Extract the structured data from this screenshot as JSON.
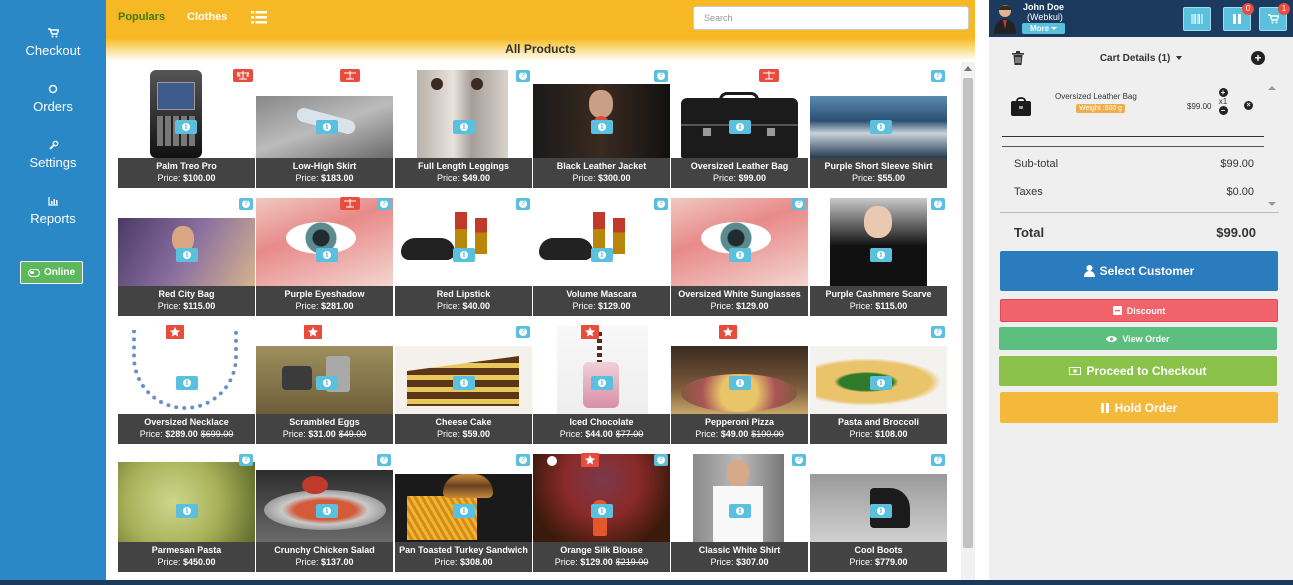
{
  "sidebar": {
    "items": [
      {
        "label": "Checkout",
        "icon": "cart-icon"
      },
      {
        "label": "Orders",
        "icon": "circle-icon"
      },
      {
        "label": "Settings",
        "icon": "wrench-icon"
      },
      {
        "label": "Reports",
        "icon": "bar-chart-icon"
      }
    ],
    "online_label": "Online"
  },
  "topbar": {
    "tabs": [
      {
        "label": "Populars"
      },
      {
        "label": "Clothes"
      }
    ],
    "search_placeholder": "Search",
    "section_title": "All Products"
  },
  "products": [
    {
      "name": "Palm Treo Pro",
      "price": "$100.00",
      "old_price": "",
      "badge": "scale"
    },
    {
      "name": "Low-High Skirt",
      "price": "$183.00",
      "old_price": "",
      "badge": "scale"
    },
    {
      "name": "Full Length Leggings",
      "price": "$49.00",
      "old_price": "",
      "badge": "question"
    },
    {
      "name": "Black Leather Jacket",
      "price": "$300.00",
      "old_price": "",
      "badge": "question"
    },
    {
      "name": "Oversized Leather Bag",
      "price": "$99.00",
      "old_price": "",
      "badge": "scale"
    },
    {
      "name": "Purple Short Sleeve Shirt",
      "price": "$55.00",
      "old_price": "",
      "badge": "question"
    },
    {
      "name": "Red City Bag",
      "price": "$115.00",
      "old_price": "",
      "badge": "question"
    },
    {
      "name": "Purple Eyeshadow",
      "price": "$281.00",
      "old_price": "",
      "badge": "scale-question"
    },
    {
      "name": "Red Lipstick",
      "price": "$40.00",
      "old_price": "",
      "badge": "question"
    },
    {
      "name": "Volume Mascara",
      "price": "$129.00",
      "old_price": "",
      "badge": "question"
    },
    {
      "name": "Oversized White Sunglasses",
      "price": "$129.00",
      "old_price": "",
      "badge": "question"
    },
    {
      "name": "Purple Cashmere Scarve",
      "price": "$115.00",
      "old_price": "",
      "badge": "question"
    },
    {
      "name": "Oversized Necklace",
      "price": "$289.00",
      "old_price": "$699.00",
      "badge": "star"
    },
    {
      "name": "Scrambled Eggs",
      "price": "$31.00",
      "old_price": "$49.00",
      "badge": "star"
    },
    {
      "name": "Cheese Cake",
      "price": "$59.00",
      "old_price": "",
      "badge": "question"
    },
    {
      "name": "Iced Chocolate",
      "price": "$44.00",
      "old_price": "$77.00",
      "badge": "star"
    },
    {
      "name": "Pepperoni Pizza",
      "price": "$49.00",
      "old_price": "$100.00",
      "badge": "star"
    },
    {
      "name": "Pasta and Broccoli",
      "price": "$108.00",
      "old_price": "",
      "badge": "question"
    },
    {
      "name": "Parmesan Pasta",
      "price": "$450.00",
      "old_price": "",
      "badge": "question"
    },
    {
      "name": "Crunchy Chicken Salad",
      "price": "$137.00",
      "old_price": "",
      "badge": "question"
    },
    {
      "name": "Pan Toasted Turkey Sandwich",
      "price": "$308.00",
      "old_price": "",
      "badge": "question"
    },
    {
      "name": "Orange Silk Blouse",
      "price": "$129.00",
      "old_price": "$219.00",
      "badge": "star-question"
    },
    {
      "name": "Classic White Shirt",
      "price": "$307.00",
      "old_price": "",
      "badge": "question"
    },
    {
      "name": "Cool Boots",
      "price": "$779.00",
      "old_price": "",
      "badge": "question"
    }
  ],
  "price_prefix": "Price:",
  "user": {
    "name": "John Doe",
    "org": "(Webkul)",
    "more_label": "More"
  },
  "header_badges": {
    "pause_count": "0",
    "cart_count": "1"
  },
  "cart": {
    "title": "Cart Details (1)",
    "items": [
      {
        "name": "Oversized Leather Bag",
        "weight": "Weight :500 g",
        "price": "$99.00",
        "qty": "x1"
      }
    ],
    "subtotal_label": "Sub-total",
    "subtotal": "$99.00",
    "taxes_label": "Taxes",
    "taxes": "$0.00",
    "total_label": "Total",
    "total": "$99.00"
  },
  "actions": {
    "select_customer": "Select Customer",
    "discount": "Discount",
    "view_order": "View Order",
    "proceed": "Proceed to Checkout",
    "hold": "Hold Order"
  },
  "colors": {
    "sidebar": "#2b88c7",
    "topbar": "#f6b825",
    "header_dark": "#1b3a5e",
    "info": "#5bc0de",
    "alert": "#e74c3c"
  }
}
